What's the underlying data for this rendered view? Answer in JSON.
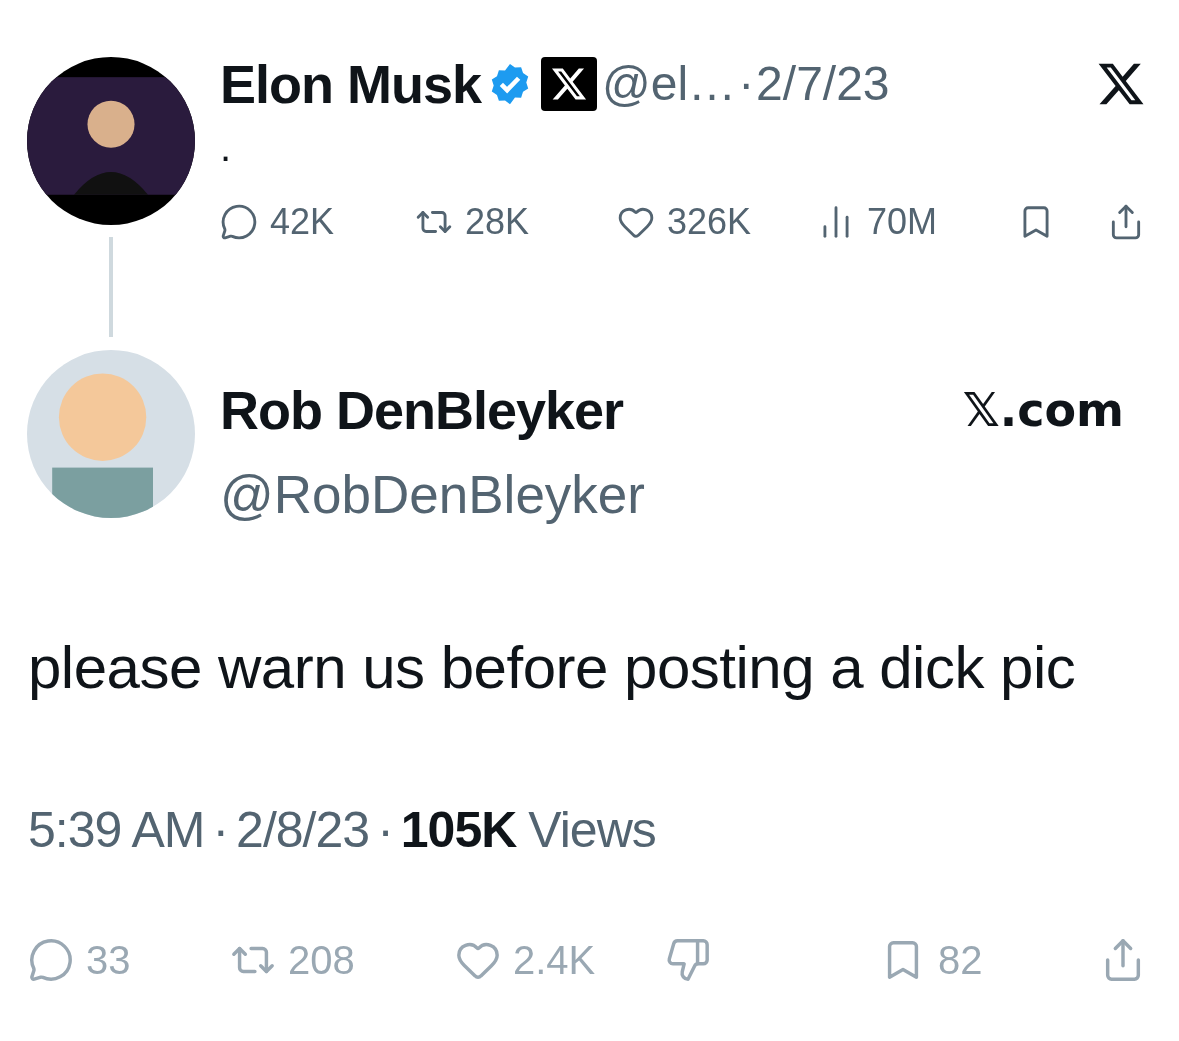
{
  "original_post": {
    "author_name": "Elon Musk",
    "verified": true,
    "handle": "@el…",
    "separator": "·",
    "date": "2/7/23",
    "text": ".",
    "stats": [
      {
        "kind": "reply",
        "count": "42K"
      },
      {
        "kind": "repost",
        "count": "28K"
      },
      {
        "kind": "like",
        "count": "326K"
      },
      {
        "kind": "views",
        "count": "70M"
      },
      {
        "kind": "bookmark"
      },
      {
        "kind": "share"
      }
    ]
  },
  "reply_post": {
    "author_name": "Rob DenBleyker",
    "handle": "@RobDenBleyker",
    "source": "𝕏.com",
    "text": "please warn us before posting a dick pic",
    "time": "5:39 AM",
    "separator": "·",
    "date": "2/8/23",
    "views_count": "105K",
    "views_label": "Views",
    "actions": [
      {
        "kind": "reply",
        "count": "33"
      },
      {
        "kind": "repost",
        "count": "208"
      },
      {
        "kind": "like",
        "count": "2.4K"
      },
      {
        "kind": "dislike"
      },
      {
        "kind": "bookmark",
        "count": "82"
      },
      {
        "kind": "share"
      }
    ]
  }
}
